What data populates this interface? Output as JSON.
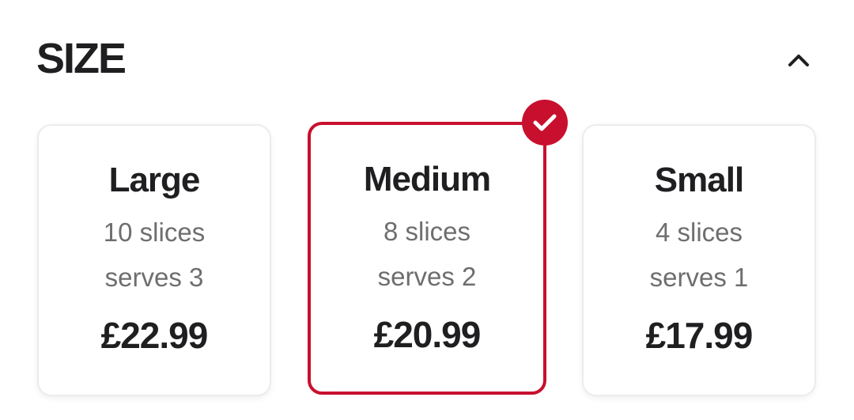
{
  "section": {
    "title": "SIZE",
    "toggle_icon": "chevron-up-icon"
  },
  "accent_color": "#c8102e",
  "sizes": [
    {
      "name": "Large",
      "slices": "10 slices",
      "serves": "serves 3",
      "price": "£22.99",
      "selected": false
    },
    {
      "name": "Medium",
      "slices": "8 slices",
      "serves": "serves 2",
      "price": "£20.99",
      "selected": true
    },
    {
      "name": "Small",
      "slices": "4 slices",
      "serves": "serves 1",
      "price": "£17.99",
      "selected": false
    }
  ],
  "selected_icon": "check-icon"
}
